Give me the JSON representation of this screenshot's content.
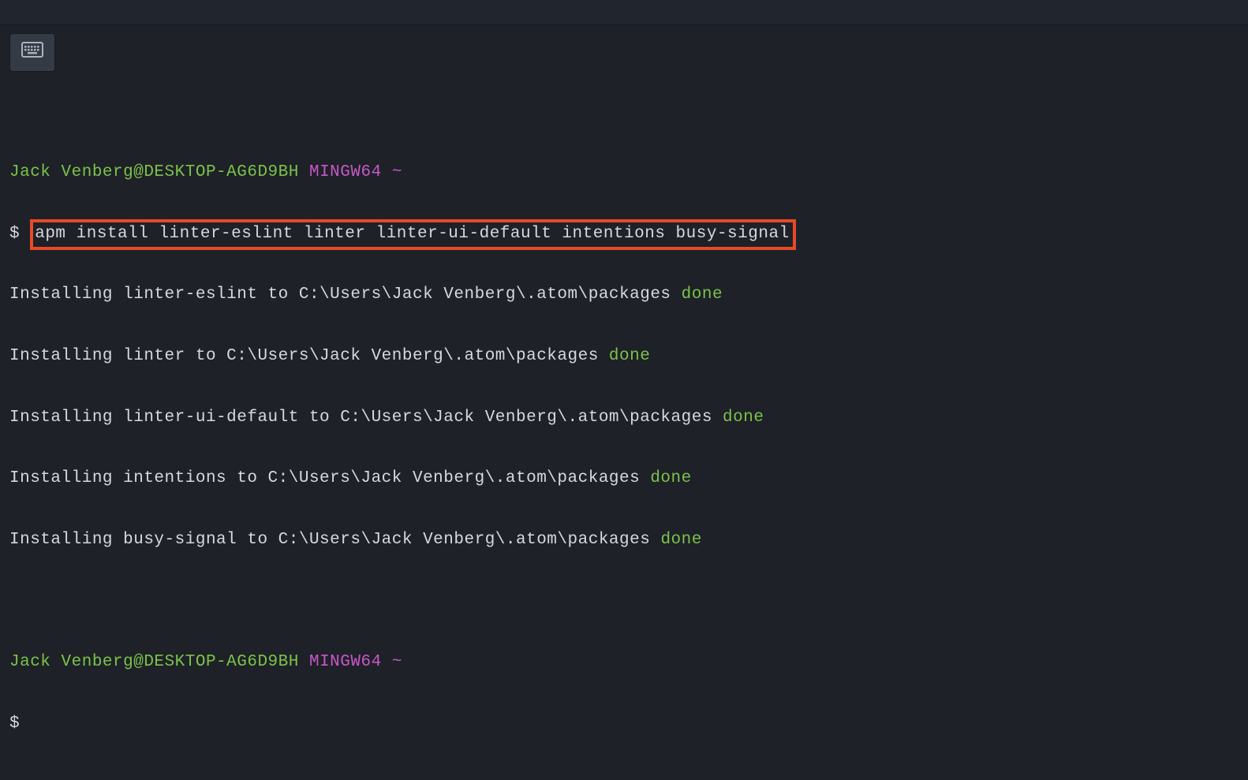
{
  "prompt1": {
    "user": "Jack Venberg@DESKTOP-AG6D9BH",
    "env": "MINGW64",
    "path": "~",
    "sigil": "$",
    "command": "apm install linter-eslint linter linter-ui-default intentions busy-signal"
  },
  "output": [
    {
      "text": "Installing linter-eslint to C:\\Users\\Jack Venberg\\.atom\\packages ",
      "status": "done"
    },
    {
      "text": "Installing linter to C:\\Users\\Jack Venberg\\.atom\\packages ",
      "status": "done"
    },
    {
      "text": "Installing linter-ui-default to C:\\Users\\Jack Venberg\\.atom\\packages ",
      "status": "done"
    },
    {
      "text": "Installing intentions to C:\\Users\\Jack Venberg\\.atom\\packages ",
      "status": "done"
    },
    {
      "text": "Installing busy-signal to C:\\Users\\Jack Venberg\\.atom\\packages ",
      "status": "done"
    }
  ],
  "prompt2": {
    "user": "Jack Venberg@DESKTOP-AG6D9BH",
    "env": "MINGW64",
    "path": "~",
    "sigil": "$"
  }
}
